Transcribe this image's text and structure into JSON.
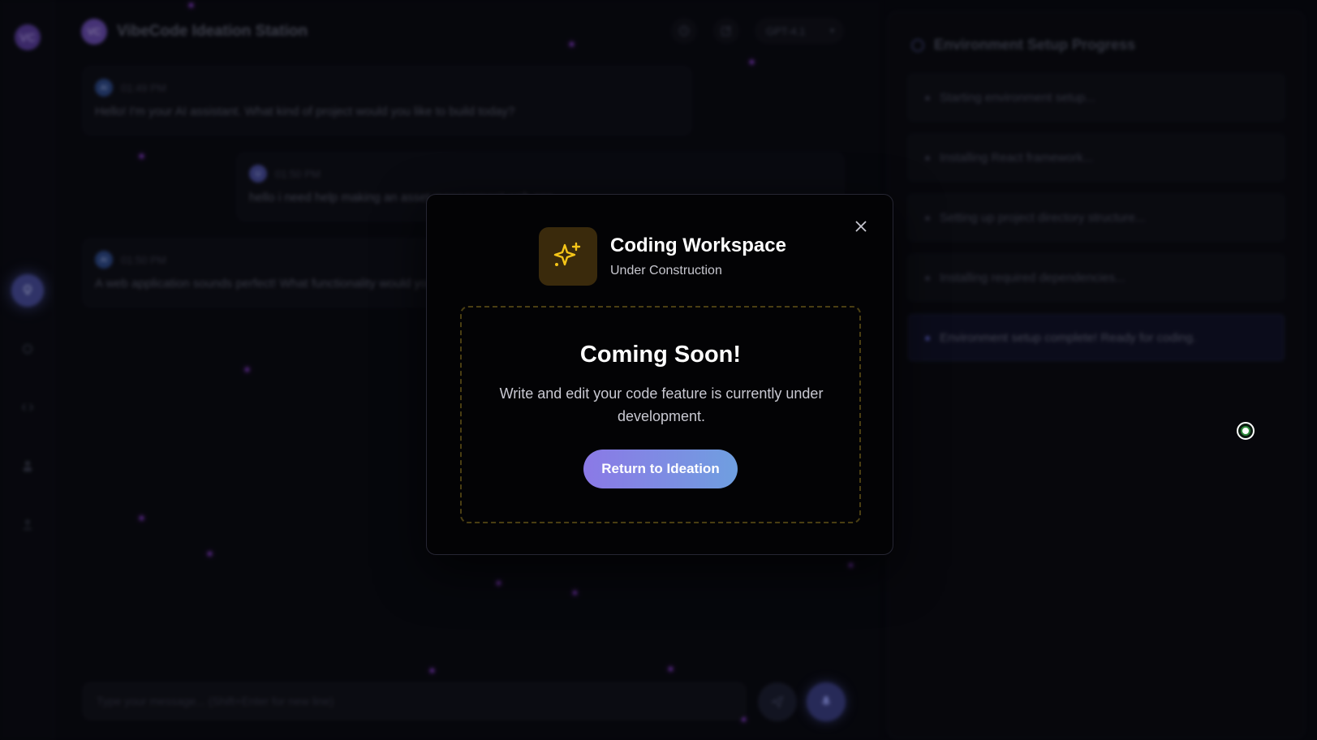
{
  "app": {
    "title": "VibeCode Ideation Station",
    "model": "GPT-4.1",
    "header_avatar": "VC",
    "sidebar_logo": "VC"
  },
  "chat": {
    "messages": [
      {
        "author": "AI",
        "time": "01:49 PM",
        "text": "Hello! I'm your AI assistant. What kind of project would you like to build today?"
      },
      {
        "author": "U",
        "time": "01:50 PM",
        "text": "hello i need help making an asset management web app"
      },
      {
        "author": "AI",
        "time": "01:50 PM",
        "text": "A web application sounds perfect! What functionality would you like your web app to have?"
      }
    ],
    "composer_placeholder": "Type your message... (Shift+Enter for new line)"
  },
  "environment": {
    "title": "Environment Setup Progress",
    "steps": [
      {
        "label": "Starting environment setup..."
      },
      {
        "label": "Installing React framework..."
      },
      {
        "label": "Setting up project directory structure..."
      },
      {
        "label": "Installing required dependencies..."
      },
      {
        "label": "Environment setup complete! Ready for coding."
      }
    ]
  },
  "modal": {
    "title": "Coding Workspace",
    "subtitle": "Under Construction",
    "heading": "Coming Soon!",
    "description": "Write and edit your code feature is currently under development.",
    "button_label": "Return to Ideation",
    "icon": "sparkles-icon",
    "close_icon": "close-icon"
  },
  "colors": {
    "accent_gradient_start": "#8b79e6",
    "accent_gradient_end": "#6f9fe0",
    "icon_gold": "#f5c518",
    "icon_bg": "#3a2a0c",
    "dashed_border": "#4a3e12",
    "modal_bg": "#030305"
  }
}
